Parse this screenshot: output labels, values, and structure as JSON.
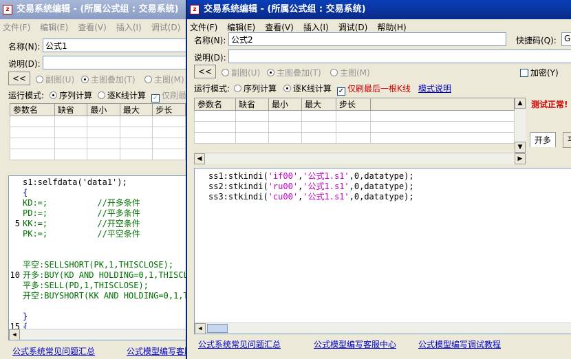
{
  "back_window": {
    "title": "交易系统编辑 - (所属公式组 : 交易系统)",
    "menu": [
      "文件(F)",
      "编辑(E)",
      "查看(V)",
      "插入(I)",
      "调试(D)"
    ],
    "name_label": "名称(N):",
    "name_value": "公式1",
    "desc_label": "说明(D):",
    "collapse_btn": "<<",
    "radio_sub": "副图(U)",
    "radio_main_overlay": "主图叠加(T)",
    "radio_main": "主图(M)",
    "run_mode_label": "运行模式:",
    "mode_sequence": "序列计算",
    "mode_kline": "逐K线计算",
    "refresh_label": "仅刷最",
    "param_headers": [
      "参数名",
      "缺省",
      "最小",
      "最大",
      "步长"
    ],
    "code_lines": [
      {
        "num": "",
        "text": "s1:selfdata('data1');",
        "color": "black"
      },
      {
        "num": "",
        "text": "{",
        "color": "blue"
      },
      {
        "num": "",
        "text": "KD:=;          //开多条件",
        "color": "green"
      },
      {
        "num": "",
        "text": "PD:=;          //平多条件",
        "color": "green"
      },
      {
        "num": "5",
        "text": "KK:=;          //开空条件",
        "color": "green"
      },
      {
        "num": "",
        "text": "PK:=;          //平空条件",
        "color": "green"
      },
      {
        "num": "",
        "text": "",
        "color": "black"
      },
      {
        "num": "",
        "text": "",
        "color": "black"
      },
      {
        "num": "",
        "text": "平空:SELLSHORT(PK,1,THISCLOSE);",
        "color": "green"
      },
      {
        "num": "10",
        "text": "开多:BUY(KD AND HOLDING=0,1,THISCL",
        "color": "green"
      },
      {
        "num": "",
        "text": "平多:SELL(PD,1,THISCLOSE);",
        "color": "green"
      },
      {
        "num": "",
        "text": "开空:BUYSHORT(KK AND HOLDING=0,1,T",
        "color": "green"
      },
      {
        "num": "",
        "text": "",
        "color": "black"
      },
      {
        "num": "",
        "text": "}",
        "color": "blue"
      },
      {
        "num": "15",
        "text": "{",
        "color": "blue"
      }
    ],
    "footer_link1": "公式系统常见问题汇总",
    "footer_link2": "公式模型编写客服中心"
  },
  "front_window": {
    "title": "交易系统编辑 - (所属公式组 : 交易系统)",
    "menu": [
      "文件(F)",
      "编辑(E)",
      "查看(V)",
      "插入(I)",
      "调试(D)",
      "帮助(H)"
    ],
    "name_label": "名称(N):",
    "name_value": "公式2",
    "shortcut_label": "快捷码(Q):",
    "shortcut_value": "GS",
    "desc_label": "说明(D):",
    "collapse_btn": "<<",
    "radio_sub": "副图(U)",
    "radio_main_overlay": "主图叠加(T)",
    "radio_main": "主图(M)",
    "encrypt_label": "加密(Y)",
    "run_mode_label": "运行模式:",
    "mode_sequence": "序列计算",
    "mode_kline": "逐K线计算",
    "refresh_last_label": "仅刷最后一根K线",
    "mode_help_link": "模式说明",
    "status_text": "测试正常!",
    "tab_kaiduo": "开多",
    "tab_ping": "平",
    "param_headers": [
      "参数名",
      "缺省",
      "最小",
      "最大",
      "步长"
    ],
    "code_lines": [
      {
        "a": "ss1:stkindi(",
        "b": "'if00'",
        "c": ",",
        "d": "'公式1.s1'",
        "e": ",0,datatype);"
      },
      {
        "a": "ss2:stkindi(",
        "b": "'ru00'",
        "c": ",",
        "d": "'公式1.s1'",
        "e": ",0,datatype);"
      },
      {
        "a": "ss3:stkindi(",
        "b": "'cu00'",
        "c": ",",
        "d": "'公式1.s1'",
        "e": ",0,datatype);"
      }
    ],
    "footer_link1": "公式系统常见问题汇总",
    "footer_link2": "公式模型编写客服中心",
    "footer_link3": "公式模型编写调试教程"
  }
}
